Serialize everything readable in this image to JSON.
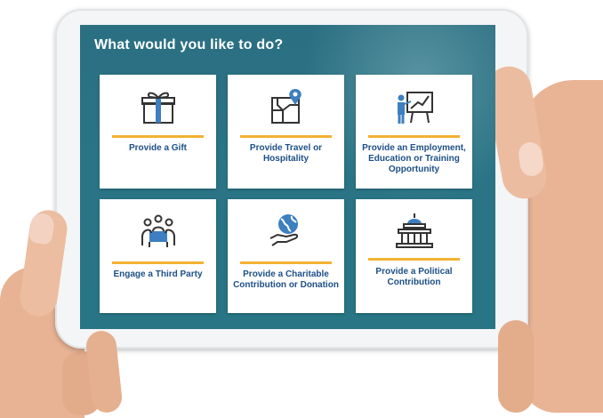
{
  "screen": {
    "title": "What would you like to do?"
  },
  "cards": [
    {
      "label": "Provide a Gift",
      "icon": "gift-icon"
    },
    {
      "label": "Provide Travel or Hospitality",
      "icon": "map-pin-icon"
    },
    {
      "label": "Provide an Employment, Education or Training Opportunity",
      "icon": "presentation-icon"
    },
    {
      "label": "Engage a Third Party",
      "icon": "meeting-icon"
    },
    {
      "label": "Provide a Charitable Contribution or Donation",
      "icon": "globe-hand-icon"
    },
    {
      "label": "Provide a Political Contribution",
      "icon": "capitol-icon"
    }
  ],
  "colors": {
    "screen_teal": "#2a7485",
    "label_blue": "#1c4f86",
    "accent_yellow": "#f2b233",
    "icon_blue": "#3d7fc0"
  }
}
